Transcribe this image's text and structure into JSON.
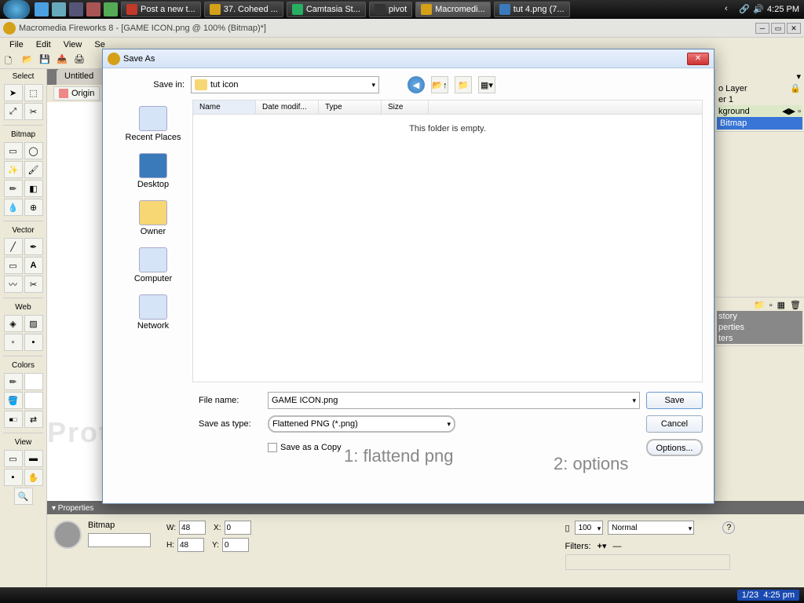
{
  "taskbar": {
    "items": [
      {
        "label": "Post a new t...",
        "color": "#c0392b"
      },
      {
        "label": "37. Coheed ...",
        "color": "#d4a017"
      },
      {
        "label": "Camtasia St...",
        "color": "#27ae60"
      },
      {
        "label": "pivot",
        "color": "#333"
      },
      {
        "label": "Macromedi...",
        "color": "#d4a017",
        "active": true
      },
      {
        "label": "tut 4.png (7...",
        "color": "#3a7aba"
      }
    ],
    "clock": "4:25 PM"
  },
  "app": {
    "title": "Macromedia Fireworks 8 - [GAME ICON.png @ 100% (Bitmap)*]",
    "menu": [
      "File",
      "Edit",
      "View",
      "Se"
    ]
  },
  "tools": {
    "sections": [
      "Select",
      "Bitmap",
      "Vector",
      "Web",
      "Colors",
      "View"
    ]
  },
  "doc": {
    "tab": "Untitled",
    "original": "Origin"
  },
  "watermark": "Protect more of your memories for less!",
  "annotations": {
    "a1": "1: flattend png",
    "a2": "2: options"
  },
  "right": {
    "lock": "🔒",
    "layer": "o Layer",
    "sub": "er 1",
    "bg": "kground",
    "bitmap": "Bitmap",
    "story": "story",
    "perties": "perties",
    "ters": "ters"
  },
  "props": {
    "hdr": "▾  Properties",
    "type": "Bitmap",
    "w": "48",
    "h": "48",
    "x": "0",
    "y": "0",
    "pct": "100",
    "blend": "Normal",
    "filters": "Filters:"
  },
  "status": {
    "date": "1/23",
    "time": "4:25 pm"
  },
  "saveas": {
    "title": "Save As",
    "savein_lbl": "Save in:",
    "savein_val": "tut icon",
    "cols": {
      "name": "Name",
      "date": "Date modif...",
      "type": "Type",
      "size": "Size"
    },
    "empty": "This folder is empty.",
    "places": [
      "Recent Places",
      "Desktop",
      "Owner",
      "Computer",
      "Network"
    ],
    "filename_lbl": "File name:",
    "filename_val": "GAME ICON.png",
    "savetype_lbl": "Save as type:",
    "savetype_val": "Flattened PNG (*.png)",
    "copy": "Save as a Copy",
    "save": "Save",
    "cancel": "Cancel",
    "options": "Options..."
  }
}
